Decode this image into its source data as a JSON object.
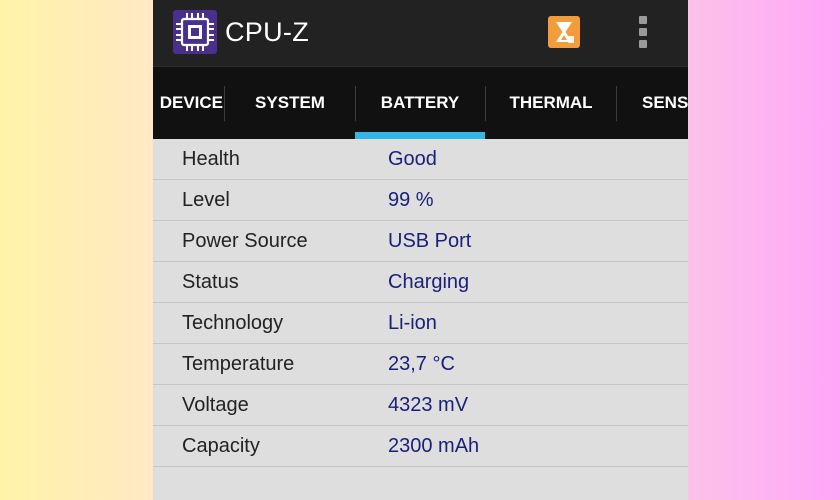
{
  "app_bar": {
    "title": "CPU-Z",
    "app_icon": "cpu-chip-icon",
    "action_icon": "bench-trophy-icon",
    "overflow_icon": "more-vert-icon",
    "accent_color": "#f39c3c"
  },
  "tabs": {
    "items": [
      {
        "label": "DEVICE"
      },
      {
        "label": "SYSTEM"
      },
      {
        "label": "BATTERY"
      },
      {
        "label": "THERMAL"
      },
      {
        "label": "SENSORS"
      }
    ],
    "selected": "BATTERY",
    "indicator_color": "#33b5e5"
  },
  "battery": {
    "rows": [
      {
        "label": "Health",
        "value": "Good"
      },
      {
        "label": "Level",
        "value": "99 %"
      },
      {
        "label": "Power Source",
        "value": "USB Port"
      },
      {
        "label": "Status",
        "value": "Charging"
      },
      {
        "label": "Technology",
        "value": "Li-ion"
      },
      {
        "label": "Temperature",
        "value": "23,7 °C"
      },
      {
        "label": "Voltage",
        "value": "4323 mV"
      },
      {
        "label": "Capacity",
        "value": "2300 mAh"
      }
    ]
  }
}
